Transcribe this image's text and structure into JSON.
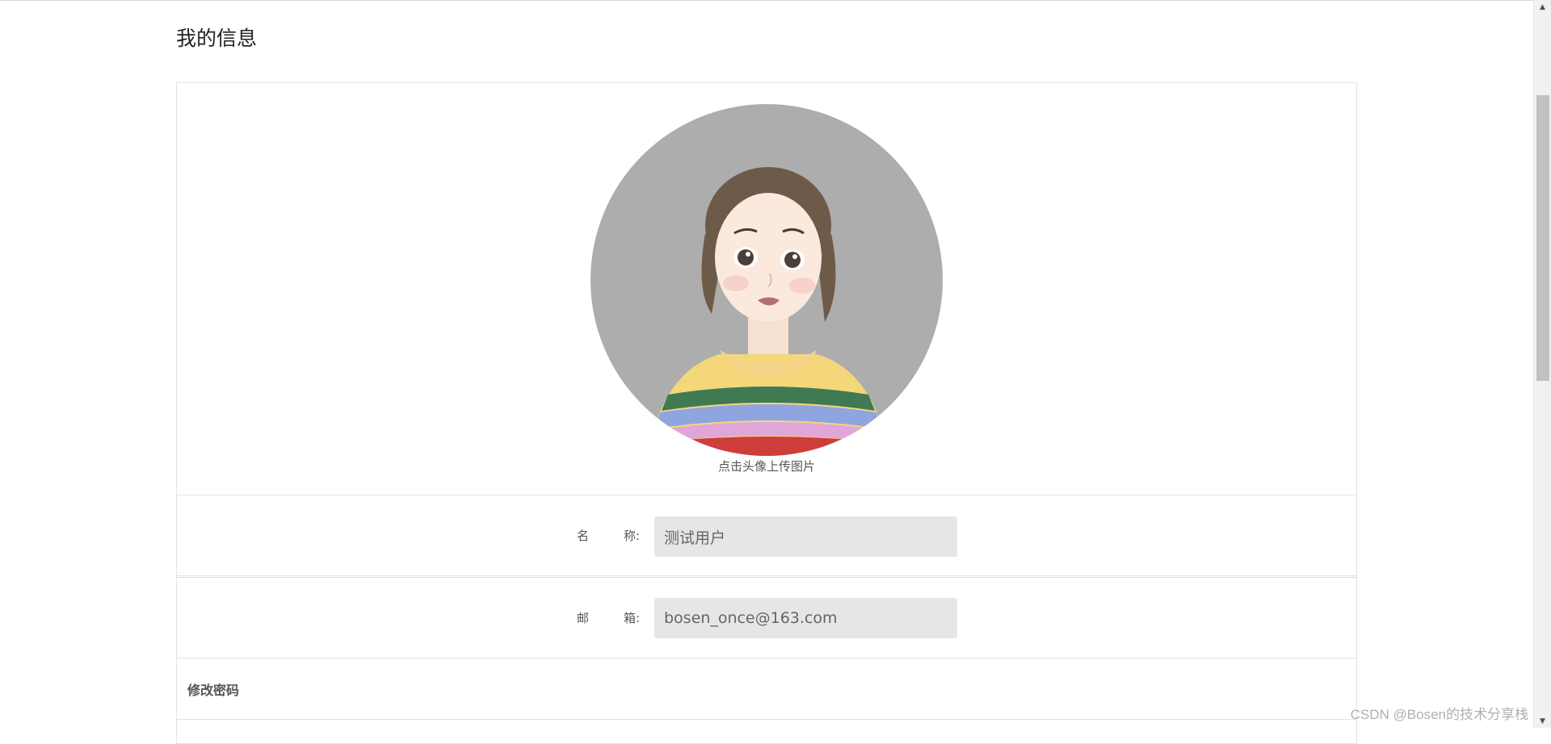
{
  "page": {
    "title": "我的信息"
  },
  "avatar": {
    "hint": "点击头像上传图片",
    "icon": "user-avatar-illustration"
  },
  "fields": {
    "name": {
      "label_char1": "名",
      "label_char2": "称:",
      "value": "测试用户"
    },
    "email": {
      "label_char1": "邮",
      "label_char2": "箱:",
      "value": "bosen_once@163.com"
    }
  },
  "password_section": {
    "title": "修改密码"
  },
  "watermark": {
    "text": "CSDN @Bosen的技术分享栈"
  },
  "colors": {
    "input_bg": "#e6e6e6",
    "avatar_bg": "#adadad",
    "border": "#e3e3e3"
  }
}
